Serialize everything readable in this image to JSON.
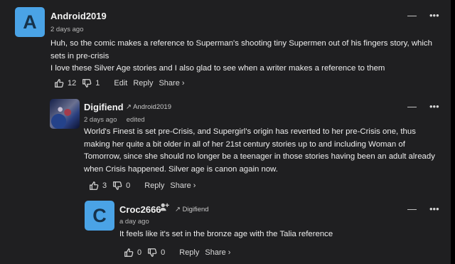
{
  "comments": [
    {
      "author": "Android2019",
      "avatar_letter": "A",
      "avatar_color": "#4aa3e6",
      "time": "2 days ago",
      "lines": [
        "Huh, so the comic makes a reference to Superman's shooting tiny Supermen out of his fingers story, which",
        "sets in pre-crisis",
        "I love these Silver Age stories and I also glad to see when a writer makes a reference to them"
      ],
      "upvotes": "12",
      "downvotes": "1",
      "edit_label": "Edit",
      "reply_label": "Reply",
      "share_label": "Share ›"
    },
    {
      "author": "Digifiend",
      "avatar_icon": "comic-avatar-image",
      "reply_to": "Android2019",
      "time": "2 days ago",
      "edited_label": "edited",
      "lines": [
        "World's Finest is set pre-Crisis, and Supergirl's origin has reverted to her pre-Crisis one, thus",
        "making her quite a bit older in all of her 21st century stories up to and including Woman of",
        "Tomorrow, since she should no longer be a teenager in those stories having been an adult already",
        "when Crisis happened. Silver age is canon again now."
      ],
      "upvotes": "3",
      "downvotes": "0",
      "reply_label": "Reply",
      "share_label": "Share ›"
    },
    {
      "author": "Croc2666",
      "avatar_letter": "C",
      "avatar_color": "#4aa3e6",
      "reply_to": "Digifiend",
      "time": "a day ago",
      "lines": [
        "It feels like it's set in the bronze age with the Talia reference"
      ],
      "upvotes": "0",
      "downvotes": "0",
      "reply_label": "Reply",
      "share_label": "Share ›"
    }
  ],
  "menu_symbols": {
    "collapse": "—",
    "more": "•••"
  }
}
